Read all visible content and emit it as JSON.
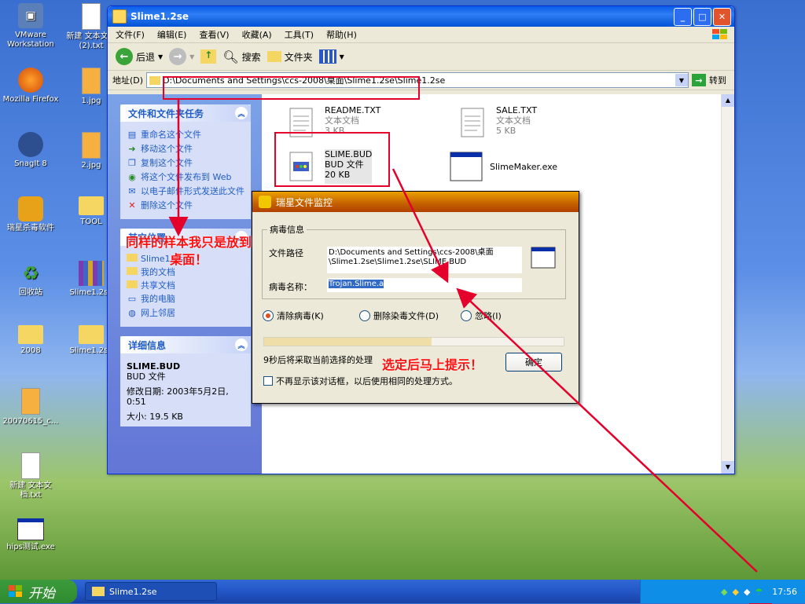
{
  "desktop": {
    "icons": [
      {
        "label": "VMware Workstation",
        "icon": "vmware-icon"
      },
      {
        "label": "新建 文本文档 (2).txt",
        "icon": "text-file-icon"
      },
      {
        "label": "Mozilla Firefox",
        "icon": "firefox-icon"
      },
      {
        "label": "1.jpg",
        "icon": "image-file-icon"
      },
      {
        "label": "SnagIt 8",
        "icon": "snagit-icon"
      },
      {
        "label": "2.jpg",
        "icon": "image-file-icon"
      },
      {
        "label": "瑞星杀毒软件",
        "icon": "rising-antivirus-icon"
      },
      {
        "label": "TOOL",
        "icon": "folder-icon"
      },
      {
        "label": "回收站",
        "icon": "recycle-bin-icon"
      },
      {
        "label": "Slime1.2se",
        "icon": "archive-icon"
      },
      {
        "label": "2008",
        "icon": "folder-icon"
      },
      {
        "label": "Slime1.2se",
        "icon": "folder-icon"
      },
      {
        "label": "20070615_c...",
        "icon": "image-file-icon"
      },
      {
        "label": "新建 文本文档.txt",
        "icon": "text-file-icon"
      },
      {
        "label": "hips测试.exe",
        "icon": "exe-icon"
      }
    ]
  },
  "explorer": {
    "title": "Slime1.2se",
    "menu": [
      "文件(F)",
      "编辑(E)",
      "查看(V)",
      "收藏(A)",
      "工具(T)",
      "帮助(H)"
    ],
    "toolbar": {
      "back": "后退",
      "search": "搜索",
      "folders": "文件夹"
    },
    "address_label": "地址(D)",
    "address_value": "D:\\Documents and Settings\\ccs-2008\\桌面\\Slime1.2se\\Slime1.2se",
    "go_label": "转到",
    "tasks": {
      "title": "文件和文件夹任务",
      "items": [
        "重命名这个文件",
        "移动这个文件",
        "复制这个文件",
        "将这个文件发布到 Web",
        "以电子邮件形式发送此文件",
        "删除这个文件"
      ]
    },
    "other_places": {
      "title": "其它位置",
      "items": [
        "Slime1.2se",
        "我的文档",
        "共享文档",
        "我的电脑",
        "网上邻居"
      ]
    },
    "details": {
      "title": "详细信息",
      "name": "SLIME.BUD",
      "type": "BUD 文件",
      "modified": "修改日期: 2003年5月2日, 0:51",
      "size": "大小: 19.5 KB"
    },
    "files": [
      {
        "name": "README.TXT",
        "type": "文本文档",
        "size": "3 KB"
      },
      {
        "name": "SALE.TXT",
        "type": "文本文档",
        "size": "5 KB"
      },
      {
        "name": "SLIME.BUD",
        "type": "BUD 文件",
        "size": "20 KB"
      },
      {
        "name": "SlimeMaker.exe",
        "type": "",
        "size": ""
      }
    ]
  },
  "dialog": {
    "title": "瑞星文件监控",
    "group": "病毒信息",
    "path_label": "文件路径",
    "path_value": "D:\\Documents and Settings\\ccs-2008\\桌面\\Slime1.2se\\Slime1.2se\\SLIME.BUD",
    "virus_label": "病毒名称：",
    "virus_value": "Trojan.Slime.a",
    "options": [
      "清除病毒(K)",
      "删除染毒文件(D)",
      "忽略(I)"
    ],
    "selected_option": 0,
    "progress": 0.56,
    "countdown_text": "9秒后将采取当前选择的处理",
    "confirm": "确定",
    "checkbox": "不再显示该对话框，以后使用相同的处理方式。"
  },
  "annotations": {
    "left": "同样的样本我只是放到桌面！",
    "right": "选定后马上提示！"
  },
  "taskbar": {
    "start": "开始",
    "task": "Slime1.2se",
    "clock": "17:56"
  },
  "colors": {
    "annotation": "#e4002b",
    "xp_blue": "#0a5ce8",
    "rising_orange": "#c46000"
  }
}
